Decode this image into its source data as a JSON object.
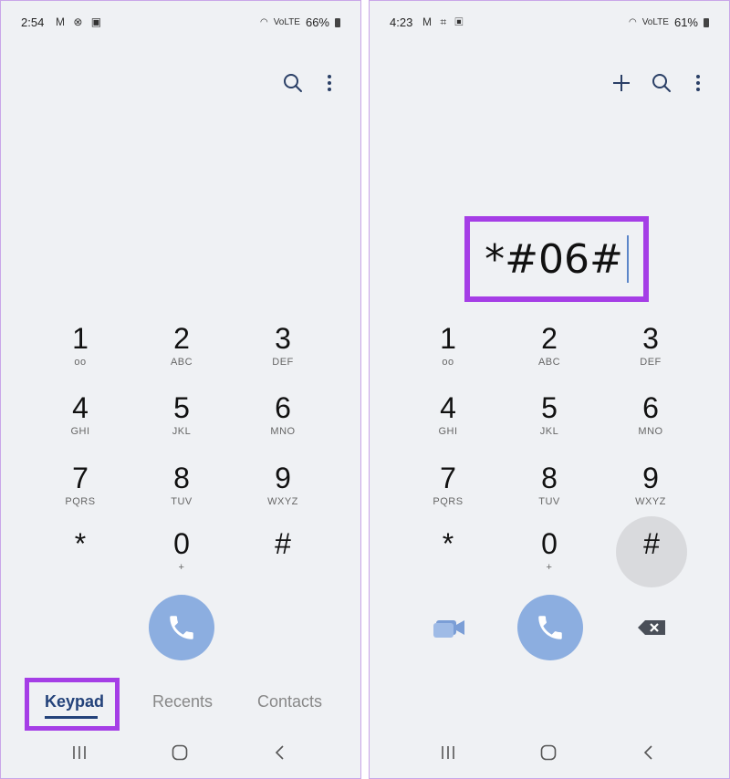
{
  "left": {
    "status": {
      "time": "2:54",
      "left_icons": "M ⊗ ▣",
      "signal_text": "VoLTE",
      "battery": "66%"
    },
    "tabs": {
      "keypad": "Keypad",
      "recents": "Recents",
      "contacts": "Contacts"
    }
  },
  "right": {
    "status": {
      "time": "4:23",
      "left_icons": "M ⌗ ▣",
      "signal_text": "VoLTE",
      "battery": "61%"
    },
    "dialed": "*#06#"
  },
  "keypad": [
    {
      "digit": "1",
      "letters": "oo"
    },
    {
      "digit": "2",
      "letters": "ABC"
    },
    {
      "digit": "3",
      "letters": "DEF"
    },
    {
      "digit": "4",
      "letters": "GHI"
    },
    {
      "digit": "5",
      "letters": "JKL"
    },
    {
      "digit": "6",
      "letters": "MNO"
    },
    {
      "digit": "7",
      "letters": "PQRS"
    },
    {
      "digit": "8",
      "letters": "TUV"
    },
    {
      "digit": "9",
      "letters": "WXYZ"
    },
    {
      "digit": "*",
      "letters": ""
    },
    {
      "digit": "0",
      "letters": "+"
    },
    {
      "digit": "#",
      "letters": ""
    }
  ],
  "icons": {
    "search": "search-icon",
    "more": "more-vertical-icon",
    "add": "plus-icon",
    "call": "phone-icon",
    "video": "video-call-icon",
    "backspace": "backspace-icon",
    "recent_apps": "recent-apps-icon",
    "home": "home-icon",
    "back": "back-icon"
  },
  "colors": {
    "highlight": "#a53ee6",
    "call_button": "#8caee0",
    "active_tab": "#23427a",
    "background": "#eff1f4"
  }
}
